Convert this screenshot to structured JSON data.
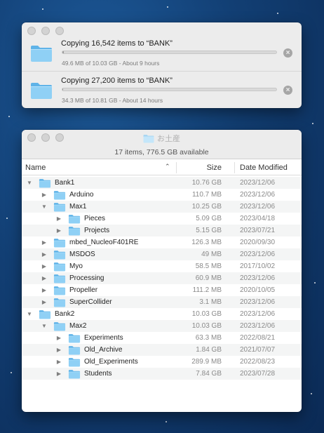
{
  "copy_window": {
    "items": [
      {
        "title": "Copying 16,542 items to “BANK”",
        "status": "49.6 MB of 10.03 GB - About 9 hours",
        "progress": 0.005
      },
      {
        "title": "Copying 27,200 items to “BANK”",
        "status": "34.3 MB of 10.81 GB - About 14 hours",
        "progress": 0.003
      }
    ]
  },
  "finder": {
    "title": "お土産",
    "status": "17 items, 776.5 GB available",
    "columns": {
      "name": "Name",
      "size": "Size",
      "date": "Date Modified"
    },
    "rows": [
      {
        "name": "Bank1",
        "level": 0,
        "expanded": true,
        "size": "10.76 GB",
        "date": "2023/12/06"
      },
      {
        "name": "Arduino",
        "level": 1,
        "expanded": false,
        "size": "110.7 MB",
        "date": "2023/12/06"
      },
      {
        "name": "Max1",
        "level": 1,
        "expanded": true,
        "size": "10.25 GB",
        "date": "2023/12/06"
      },
      {
        "name": "Pieces",
        "level": 2,
        "expanded": false,
        "size": "5.09 GB",
        "date": "2023/04/18"
      },
      {
        "name": "Projects",
        "level": 2,
        "expanded": false,
        "size": "5.15 GB",
        "date": "2023/07/21"
      },
      {
        "name": "mbed_NucleoF401RE",
        "level": 1,
        "expanded": false,
        "size": "126.3 MB",
        "date": "2020/09/30"
      },
      {
        "name": "MSDOS",
        "level": 1,
        "expanded": false,
        "size": "49 MB",
        "date": "2023/12/06"
      },
      {
        "name": "Myo",
        "level": 1,
        "expanded": false,
        "size": "58.5 MB",
        "date": "2017/10/02"
      },
      {
        "name": "Processing",
        "level": 1,
        "expanded": false,
        "size": "60.9 MB",
        "date": "2023/12/06"
      },
      {
        "name": "Propeller",
        "level": 1,
        "expanded": false,
        "size": "111.2 MB",
        "date": "2020/10/05"
      },
      {
        "name": "SuperCollider",
        "level": 1,
        "expanded": false,
        "size": "3.1 MB",
        "date": "2023/12/06"
      },
      {
        "name": "Bank2",
        "level": 0,
        "expanded": true,
        "size": "10.03 GB",
        "date": "2023/12/06"
      },
      {
        "name": "Max2",
        "level": 1,
        "expanded": true,
        "size": "10.03 GB",
        "date": "2023/12/06"
      },
      {
        "name": "Experiments",
        "level": 2,
        "expanded": false,
        "size": "63.3 MB",
        "date": "2022/08/21"
      },
      {
        "name": "Old_Archive",
        "level": 2,
        "expanded": false,
        "size": "1.84 GB",
        "date": "2021/07/07"
      },
      {
        "name": "Old_Experiments",
        "level": 2,
        "expanded": false,
        "size": "289.9 MB",
        "date": "2022/08/23"
      },
      {
        "name": "Students",
        "level": 2,
        "expanded": false,
        "size": "7.84 GB",
        "date": "2023/07/28"
      }
    ]
  },
  "colors": {
    "folder_light": "#8fd0f5",
    "folder_dark": "#5fb3e8",
    "desktop": "#123f74"
  },
  "icons": {
    "folder": "folder-icon",
    "expanded": "triangle-down-icon",
    "collapsed": "triangle-right-icon",
    "stop": "stop-icon",
    "sort": "chevron-up-icon"
  }
}
